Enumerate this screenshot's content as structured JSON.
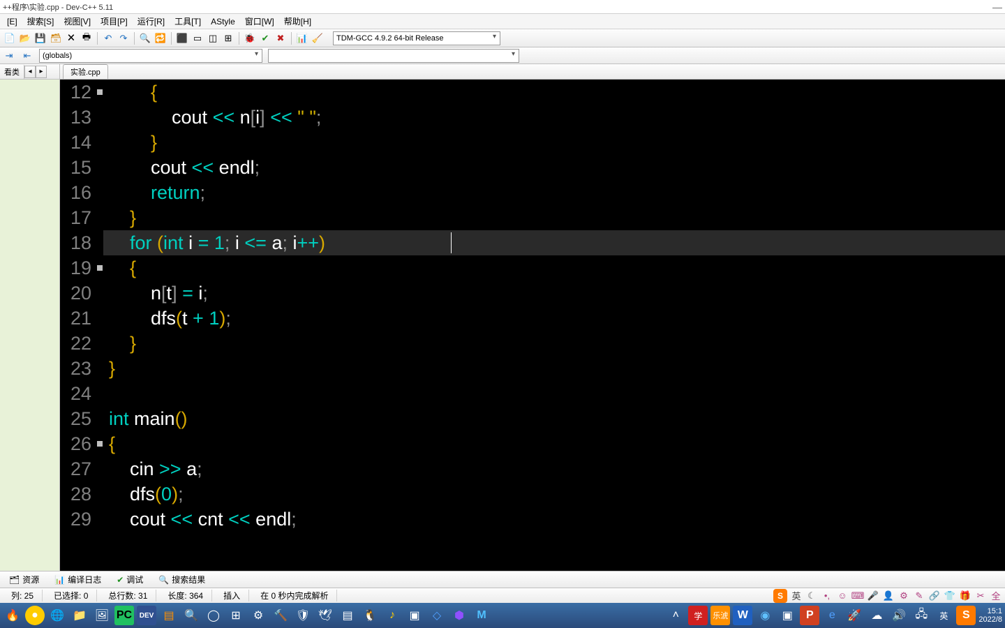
{
  "title": "++程序\\实验.cpp - Dev-C++ 5.11",
  "menu": {
    "edit": "[E]",
    "search": "搜索[S]",
    "view": "视图[V]",
    "project": "项目[P]",
    "run": "运行[R]",
    "tools": "工具[T]",
    "astyle": "AStyle",
    "window": "窗口[W]",
    "help": "帮助[H]"
  },
  "compiler_profile": "TDM-GCC 4.9.2 64-bit Release",
  "globals_label": "(globals)",
  "sidetab": "看类",
  "filetab": "实验.cpp",
  "code": {
    "first_line": 12,
    "lines": [
      [
        [
          "pn",
          "        {"
        ]
      ],
      [
        [
          "id",
          "            cout "
        ],
        [
          "op",
          "<< "
        ],
        [
          "id",
          "n"
        ],
        [
          "punc",
          "["
        ],
        [
          "id",
          "i"
        ],
        [
          "punc",
          "]"
        ],
        [
          "id",
          " "
        ],
        [
          "op",
          "<< "
        ],
        [
          "str",
          "\" \""
        ],
        [
          "punc",
          ";"
        ]
      ],
      [
        [
          "pn",
          "        }"
        ]
      ],
      [
        [
          "id",
          "        cout "
        ],
        [
          "op",
          "<< "
        ],
        [
          "id",
          "endl"
        ],
        [
          "punc",
          ";"
        ]
      ],
      [
        [
          "kw",
          "        return"
        ],
        [
          "punc",
          ";"
        ]
      ],
      [
        [
          "pn",
          "    }"
        ]
      ],
      [
        [
          "kw",
          "    for "
        ],
        [
          "pn",
          "("
        ],
        [
          "type",
          "int "
        ],
        [
          "id",
          "i "
        ],
        [
          "op",
          "= "
        ],
        [
          "num",
          "1"
        ],
        [
          "punc",
          "; "
        ],
        [
          "id",
          "i "
        ],
        [
          "op",
          "<= "
        ],
        [
          "id",
          "a"
        ],
        [
          "punc",
          "; "
        ],
        [
          "id",
          "i"
        ],
        [
          "op",
          "++"
        ],
        [
          "pn",
          ")"
        ]
      ],
      [
        [
          "pn",
          "    {"
        ]
      ],
      [
        [
          "id",
          "        n"
        ],
        [
          "punc",
          "["
        ],
        [
          "id",
          "t"
        ],
        [
          "punc",
          "]"
        ],
        [
          "id",
          " "
        ],
        [
          "op",
          "= "
        ],
        [
          "id",
          "i"
        ],
        [
          "punc",
          ";"
        ]
      ],
      [
        [
          "fn",
          "        dfs"
        ],
        [
          "pn",
          "("
        ],
        [
          "id",
          "t "
        ],
        [
          "op",
          "+ "
        ],
        [
          "num",
          "1"
        ],
        [
          "pn",
          ")"
        ],
        [
          "punc",
          ";"
        ]
      ],
      [
        [
          "pn",
          "    }"
        ]
      ],
      [
        [
          "pn",
          "}"
        ]
      ],
      [],
      [
        [
          "type",
          "int "
        ],
        [
          "fn",
          "main"
        ],
        [
          "pn",
          "()"
        ]
      ],
      [
        [
          "pn",
          "{"
        ]
      ],
      [
        [
          "id",
          "    cin "
        ],
        [
          "op",
          ">> "
        ],
        [
          "id",
          "a"
        ],
        [
          "punc",
          ";"
        ]
      ],
      [
        [
          "fn",
          "    dfs"
        ],
        [
          "pn",
          "("
        ],
        [
          "num",
          "0"
        ],
        [
          "pn",
          ")"
        ],
        [
          "punc",
          ";"
        ]
      ],
      [
        [
          "id",
          "    cout "
        ],
        [
          "op",
          "<< "
        ],
        [
          "id",
          "cnt "
        ],
        [
          "op",
          "<< "
        ],
        [
          "id",
          "endl"
        ],
        [
          "punc",
          ";"
        ]
      ]
    ],
    "highlight_index": 6,
    "fold_markers": [
      0,
      7,
      14
    ]
  },
  "bottom_tabs": {
    "res": "资源",
    "log": "编译日志",
    "dbg": "调试",
    "find": "搜索结果"
  },
  "status": {
    "col": "列:  25",
    "sel": "已选择:  0",
    "total": "总行数:  31",
    "len": "长度:  364",
    "ins": "插入",
    "parse": "在 0 秒内完成解析"
  },
  "tray": {
    "ime": "英",
    "time": "15:1",
    "date": "2022/8",
    "extra": "全"
  }
}
